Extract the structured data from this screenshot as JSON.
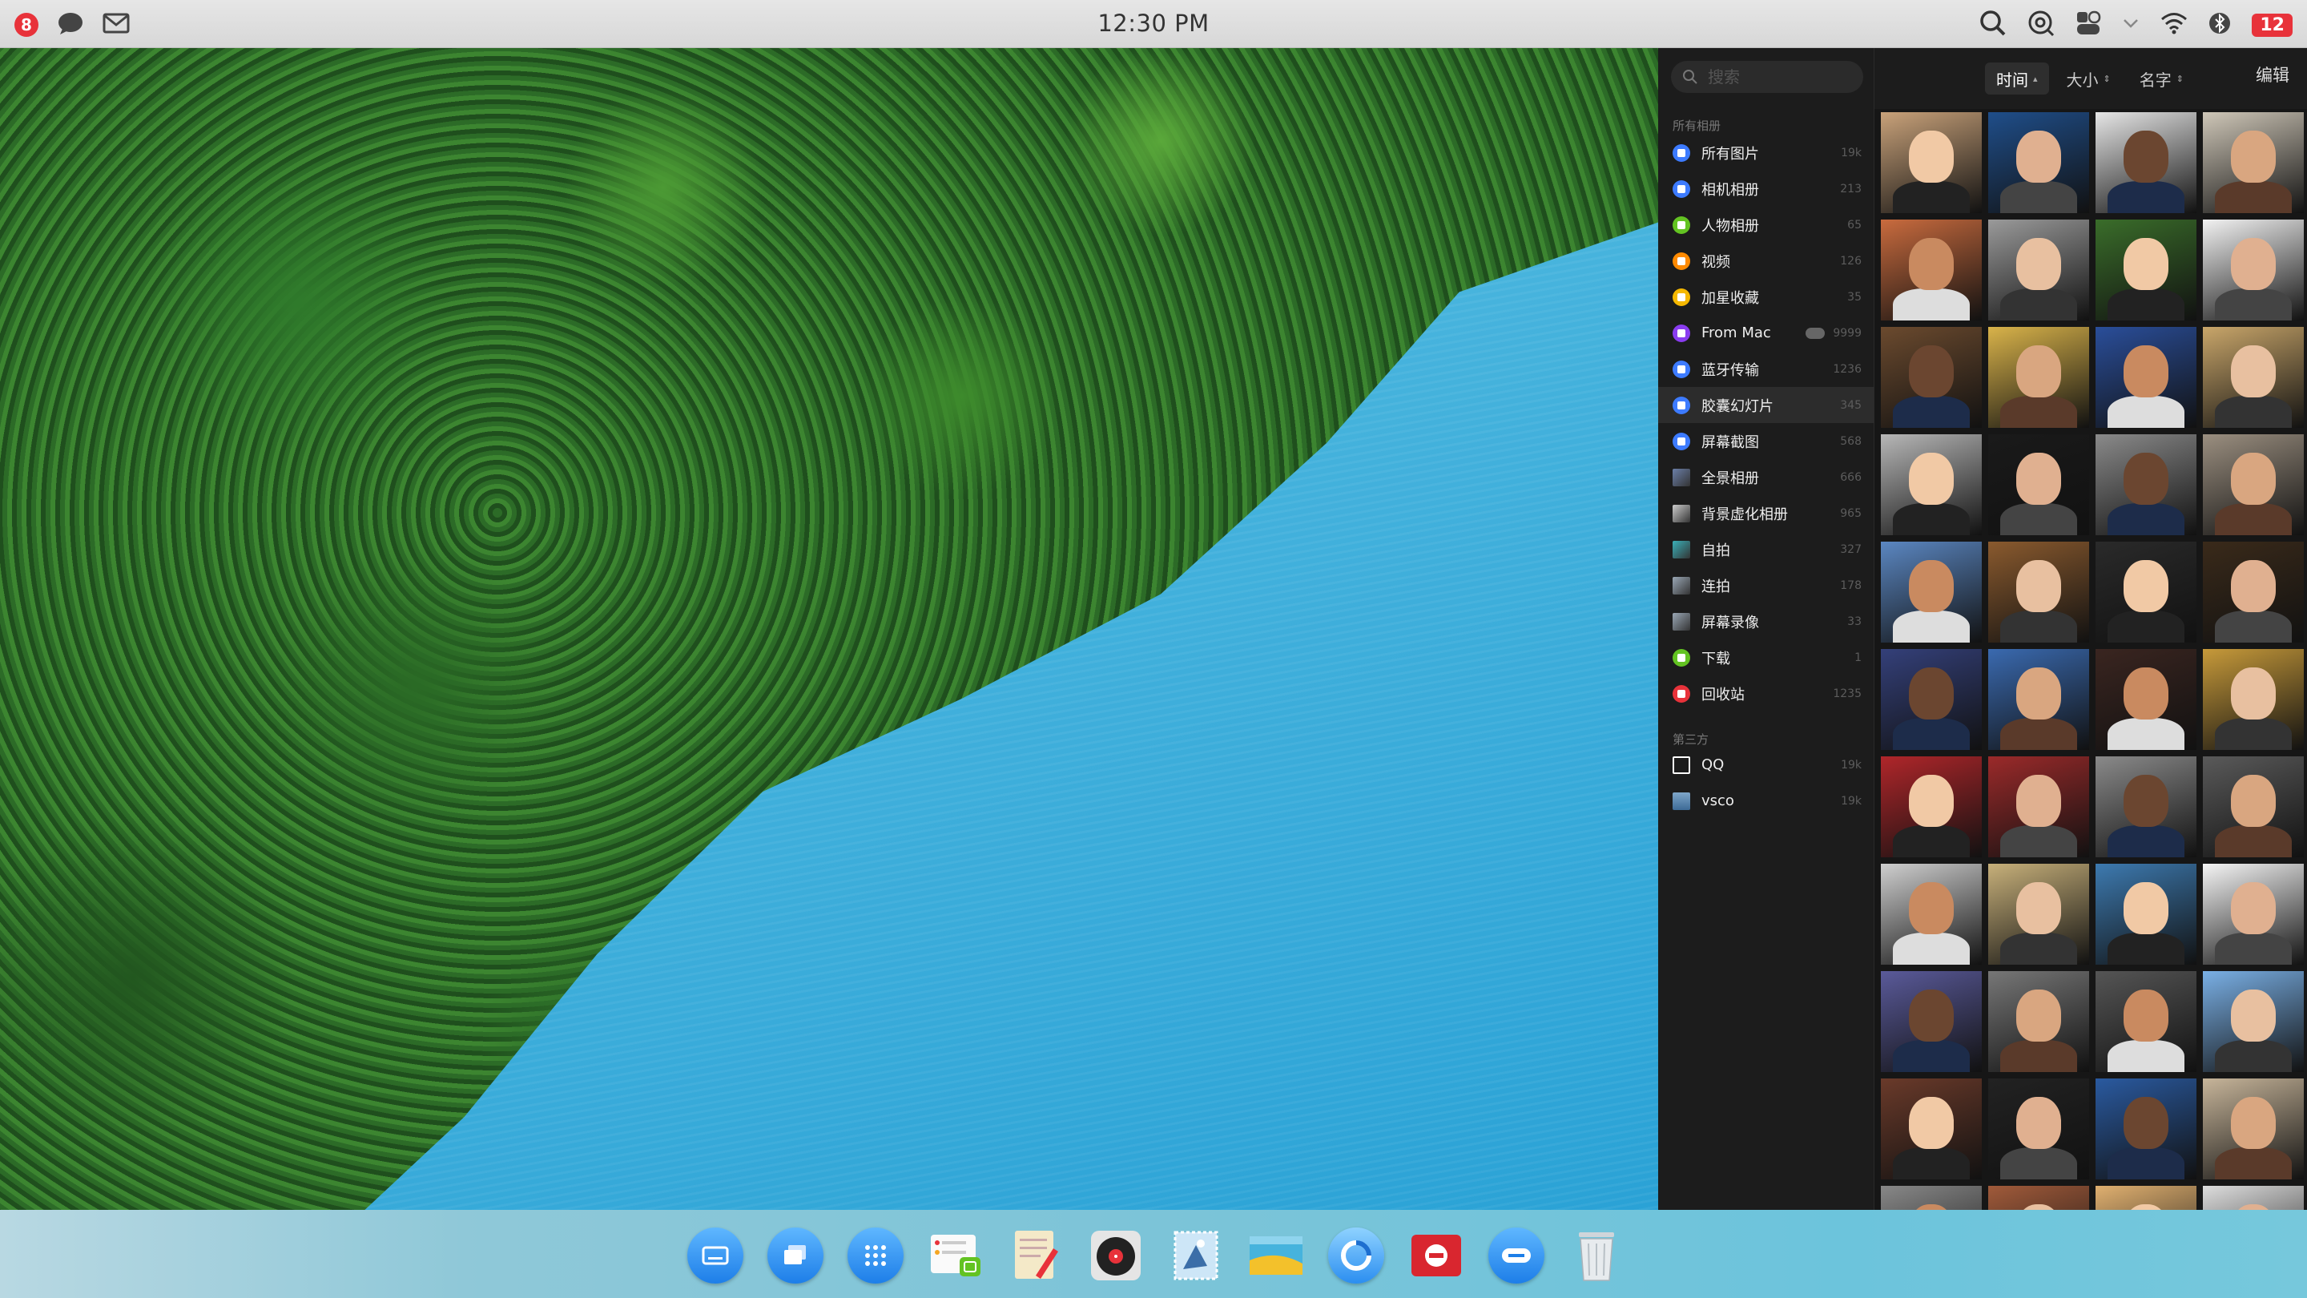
{
  "menubar": {
    "notification_count": "8",
    "clock": "12:30 PM",
    "unread_count": "12"
  },
  "photos": {
    "search_placeholder": "搜索",
    "sort": [
      {
        "label": "时间",
        "arrow": "▴"
      },
      {
        "label": "大小",
        "arrow": "⇕"
      },
      {
        "label": "名字",
        "arrow": "⇕"
      }
    ],
    "edit_label": "编辑",
    "section_all": "所有相册",
    "section_third": "第三方",
    "albums": [
      {
        "label": "所有图片",
        "count": "19k",
        "color": "#3d7bff"
      },
      {
        "label": "相机相册",
        "count": "213",
        "color": "#3d7bff"
      },
      {
        "label": "人物相册",
        "count": "65",
        "color": "#63c322"
      },
      {
        "label": "视频",
        "count": "126",
        "color": "#ff8a00"
      },
      {
        "label": "加星收藏",
        "count": "35",
        "color": "#f5b800"
      },
      {
        "label": "From Mac",
        "count": "9999",
        "color": "#8a3cf0"
      },
      {
        "label": "蓝牙传输",
        "count": "1236",
        "color": "#3d7bff"
      },
      {
        "label": "胶囊幻灯片",
        "count": "345",
        "color": "#3d7bff"
      },
      {
        "label": "屏幕截图",
        "count": "568",
        "color": "#3d7bff"
      },
      {
        "label": "全景相册",
        "count": "666",
        "color": "#6b7fa8"
      },
      {
        "label": "背景虚化相册",
        "count": "965",
        "color": "#cccccc"
      },
      {
        "label": "自拍",
        "count": "327",
        "color": "#3ab0b8"
      },
      {
        "label": "连拍",
        "count": "178",
        "color": "#9aa7b5"
      },
      {
        "label": "屏幕录像",
        "count": "33",
        "color": "#9aa7b5"
      },
      {
        "label": "下载",
        "count": "1",
        "color": "#63c322"
      },
      {
        "label": "回收站",
        "count": "1235",
        "color": "#e8323a"
      }
    ],
    "third_party": [
      {
        "label": "QQ",
        "count": "19k"
      },
      {
        "label": "vsco",
        "count": "19k"
      }
    ]
  },
  "dock": [
    {
      "name": "keyboard"
    },
    {
      "name": "windows"
    },
    {
      "name": "launcher"
    },
    {
      "name": "notes"
    },
    {
      "name": "editor"
    },
    {
      "name": "music"
    },
    {
      "name": "mail"
    },
    {
      "name": "photos"
    },
    {
      "name": "browser"
    },
    {
      "name": "store"
    },
    {
      "name": "messages"
    },
    {
      "name": "trash"
    }
  ]
}
